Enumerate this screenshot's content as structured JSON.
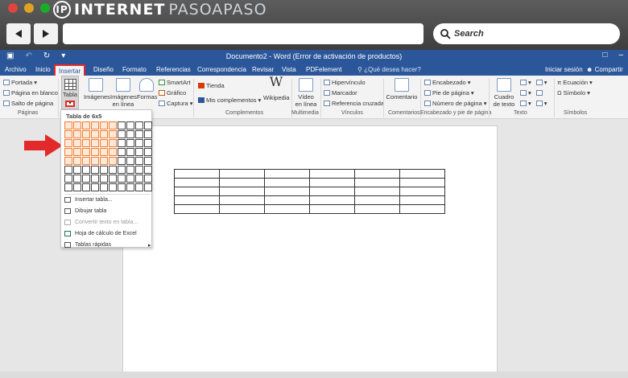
{
  "browser": {
    "logo_main": "INTERNET",
    "logo_accent": "PASOAPASO",
    "logo_mark": "IP",
    "search_label": "Search",
    "dot_colors": [
      "#e0443e",
      "#dea123",
      "#1aab29"
    ]
  },
  "word": {
    "window_title": "Documento2 - Word (Error de activación de productos)",
    "tabs": [
      "Archivo",
      "Inicio",
      "Insertar",
      "Diseño",
      "Formato",
      "Referencias",
      "Correspondencia",
      "Revisar",
      "Vista",
      "PDFelement"
    ],
    "active_tab": "Insertar",
    "tell_me": "¿Qué desea hacer?",
    "sign_in": "Iniciar sesión",
    "share": "Compartir",
    "accent_color": "#2b579a",
    "highlight_color": "#e32a2a"
  },
  "ribbon": {
    "pages": {
      "portada": "Portada",
      "blank": "Página en blanco",
      "break": "Salto de página",
      "label": "Páginas"
    },
    "tables": {
      "tabla": "Tabla"
    },
    "illustrations": {
      "imagenes": "Imágenes",
      "imagenes_linea": "Imágenes en línea",
      "formas": "Formas",
      "smartart": "SmartArt",
      "grafico": "Gráfico",
      "captura": "Captura"
    },
    "addins": {
      "tienda": "Tienda",
      "mis": "Mis complementos",
      "wikipedia": "Wikipedia",
      "label": "Complementos"
    },
    "multimedia": {
      "video": "Vídeo en línea",
      "label": "Multimedia"
    },
    "links": {
      "hyper": "Hipervínculo",
      "marcador": "Marcador",
      "ref": "Referencia cruzada",
      "label": "Vínculos"
    },
    "comments": {
      "comentario": "Comentario",
      "label": "Comentarios"
    },
    "header_footer": {
      "enc": "Encabezado",
      "pie": "Pie de página",
      "num": "Número de página",
      "label": "Encabezado y pie de página"
    },
    "text": {
      "cuadro": "Cuadro de texto",
      "label": "Texto"
    },
    "symbols": {
      "ecuacion": "Ecuación",
      "simbolo": "Símbolo",
      "label": "Símbolos"
    }
  },
  "table_dropdown": {
    "title": "Tabla de 6x5",
    "grid_cols": 10,
    "grid_rows": 8,
    "selected_cols": 6,
    "selected_rows": 5,
    "items": [
      {
        "label": "Insertar tabla...",
        "enabled": true
      },
      {
        "label": "Dibujar tabla",
        "enabled": true
      },
      {
        "label": "Convertir texto en tabla...",
        "enabled": false
      },
      {
        "label": "Hoja de cálculo de Excel",
        "enabled": true
      },
      {
        "label": "Tablas rápidas",
        "enabled": true
      }
    ]
  },
  "document_table": {
    "cols": 6,
    "rows": 5
  }
}
